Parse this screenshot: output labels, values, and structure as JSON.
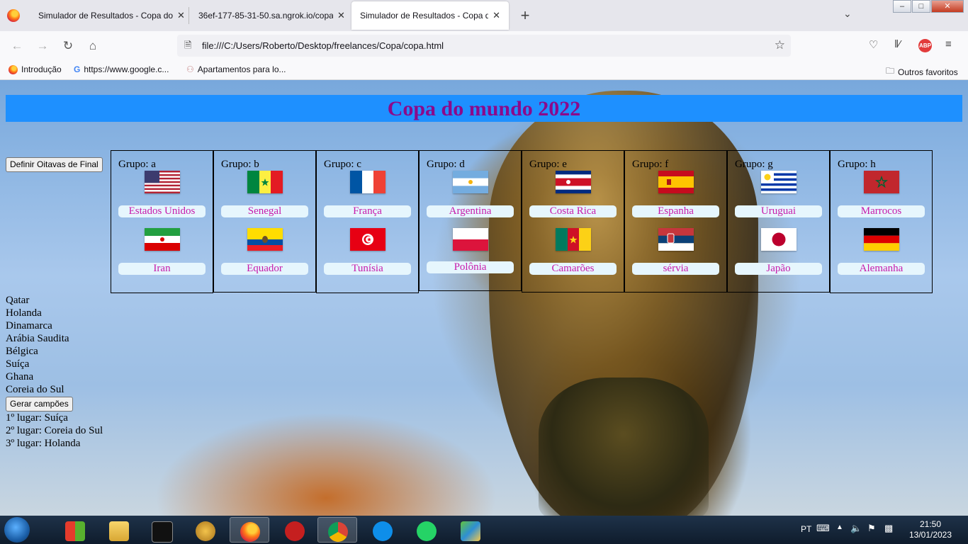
{
  "browser": {
    "tabs": [
      {
        "title": "Simulador de Resultados - Copa do",
        "active": false
      },
      {
        "title": "36ef-177-85-31-50.sa.ngrok.io/copa",
        "active": false
      },
      {
        "title": "Simulador de Resultados - Copa do",
        "active": true
      }
    ],
    "tab_close": "✕",
    "new_tab": "+",
    "url": "file:///C:/Users/Roberto/Desktop/freelances/Copa/copa.html",
    "bookmarks": [
      {
        "label": "Introdução",
        "icon": "firefox-icon"
      },
      {
        "label": "https://www.google.c...",
        "icon": "google-icon"
      },
      {
        "label": "Apartamentos para lo...",
        "icon": "site-icon"
      }
    ],
    "other_bookmarks": "Outros favoritos",
    "abp": "ABP"
  },
  "page": {
    "title": "Copa do mundo 2022",
    "define_button": "Definir Oitavas de Final",
    "generate_button": "Gerar campões",
    "groups": [
      {
        "label": "Grupo: a",
        "teams": [
          "Estados Unidos",
          "Iran"
        ],
        "flags": [
          "usa-flag",
          "iran-flag"
        ]
      },
      {
        "label": "Grupo: b",
        "teams": [
          "Senegal",
          "Equador"
        ],
        "flags": [
          "senegal-flag",
          "ecuador-flag"
        ]
      },
      {
        "label": "Grupo: c",
        "teams": [
          "França",
          "Tunísia"
        ],
        "flags": [
          "france-flag",
          "tunisia-flag"
        ]
      },
      {
        "label": "Grupo: d",
        "teams": [
          "Argentina",
          "Polônia"
        ],
        "flags": [
          "argentina-flag",
          "poland-flag"
        ]
      },
      {
        "label": "Grupo: e",
        "teams": [
          "Costa Rica",
          "Camarões"
        ],
        "flags": [
          "costa-rica-flag",
          "cameroon-flag"
        ]
      },
      {
        "label": "Grupo: f",
        "teams": [
          "Espanha",
          "sérvia"
        ],
        "flags": [
          "spain-flag",
          "serbia-flag"
        ]
      },
      {
        "label": "Grupo: g",
        "teams": [
          "Uruguai",
          "Japão"
        ],
        "flags": [
          "uruguay-flag",
          "japan-flag"
        ]
      },
      {
        "label": "Grupo: h",
        "teams": [
          "Marrocos",
          "Alemanha"
        ],
        "flags": [
          "morocco-flag",
          "germany-flag"
        ]
      }
    ],
    "other_teams": [
      "Qatar",
      "Holanda",
      "Dinamarca",
      "Arábia Saudita",
      "Bélgica",
      "Suíça",
      "Ghana",
      "Coreia do Sul"
    ],
    "results": [
      "1º lugar: Suíça",
      "2º lugar: Coreia do Sul",
      "3º lugar: Holanda"
    ],
    "colors": {
      "title_bg": "#1e90ff",
      "title_text": "#8b0a8b",
      "team_text": "#c71aab",
      "team_bg": "#e6f6fd"
    }
  },
  "taskbar": {
    "lang": "PT",
    "time": "21:50",
    "date": "13/01/2023",
    "apps": [
      "windows-icon",
      "file-explorer-icon",
      "cmd-icon",
      "genie-icon",
      "firefox-icon",
      "pokerstars-icon",
      "chrome-icon",
      "teamviewer-icon",
      "whatsapp-icon",
      "bluestacks-icon"
    ]
  }
}
